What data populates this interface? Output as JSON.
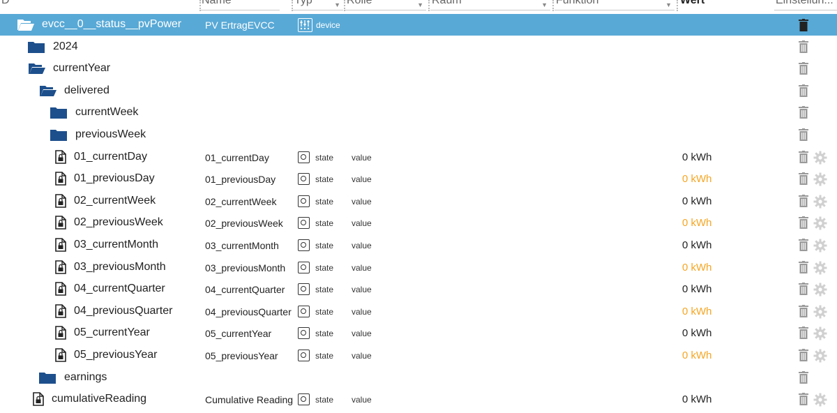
{
  "header": {
    "id_label": "D",
    "name_label": "Name",
    "type_label": "Typ",
    "role_label": "Rolle",
    "room_label": "Raum",
    "function_label": "Funktion",
    "value_label": "Wert",
    "settings_label": "Einstellun..."
  },
  "rows": [
    {
      "name": "evcc__0__status__pvPower",
      "display_name": "PV ErtragEVCC",
      "type": "device",
      "role": "",
      "value": ""
    },
    {
      "name": "2024",
      "display_name": "",
      "type": "",
      "role": "",
      "value": ""
    },
    {
      "name": "currentYear",
      "display_name": "",
      "type": "",
      "role": "",
      "value": ""
    },
    {
      "name": "delivered",
      "display_name": "",
      "type": "",
      "role": "",
      "value": ""
    },
    {
      "name": "currentWeek",
      "display_name": "",
      "type": "",
      "role": "",
      "value": ""
    },
    {
      "name": "previousWeek",
      "display_name": "",
      "type": "",
      "role": "",
      "value": ""
    },
    {
      "name": "01_currentDay",
      "display_name": "01_currentDay",
      "type": "state",
      "role": "value",
      "value": "0 kWh"
    },
    {
      "name": "01_previousDay",
      "display_name": "01_previousDay",
      "type": "state",
      "role": "value",
      "value": "0 kWh"
    },
    {
      "name": "02_currentWeek",
      "display_name": "02_currentWeek",
      "type": "state",
      "role": "value",
      "value": "0 kWh"
    },
    {
      "name": "02_previousWeek",
      "display_name": "02_previousWeek",
      "type": "state",
      "role": "value",
      "value": "0 kWh"
    },
    {
      "name": "03_currentMonth",
      "display_name": "03_currentMonth",
      "type": "state",
      "role": "value",
      "value": "0 kWh"
    },
    {
      "name": "03_previousMonth",
      "display_name": "03_previousMonth",
      "type": "state",
      "role": "value",
      "value": "0 kWh"
    },
    {
      "name": "04_currentQuarter",
      "display_name": "04_currentQuarter",
      "type": "state",
      "role": "value",
      "value": "0 kWh"
    },
    {
      "name": "04_previousQuarter",
      "display_name": "04_previousQuarter",
      "type": "state",
      "role": "value",
      "value": "0 kWh"
    },
    {
      "name": "05_currentYear",
      "display_name": "05_currentYear",
      "type": "state",
      "role": "value",
      "value": "0 kWh"
    },
    {
      "name": "05_previousYear",
      "display_name": "05_previousYear",
      "type": "state",
      "role": "value",
      "value": "0 kWh"
    },
    {
      "name": "earnings",
      "display_name": "",
      "type": "",
      "role": "",
      "value": ""
    },
    {
      "name": "cumulativeReading",
      "display_name": "Cumulative Reading",
      "type": "state",
      "role": "value",
      "value": "0 kWh"
    }
  ],
  "colors": {
    "selection": "#58a9d6",
    "folder": "#1d4f8c",
    "value_alt": "#f5a623"
  }
}
